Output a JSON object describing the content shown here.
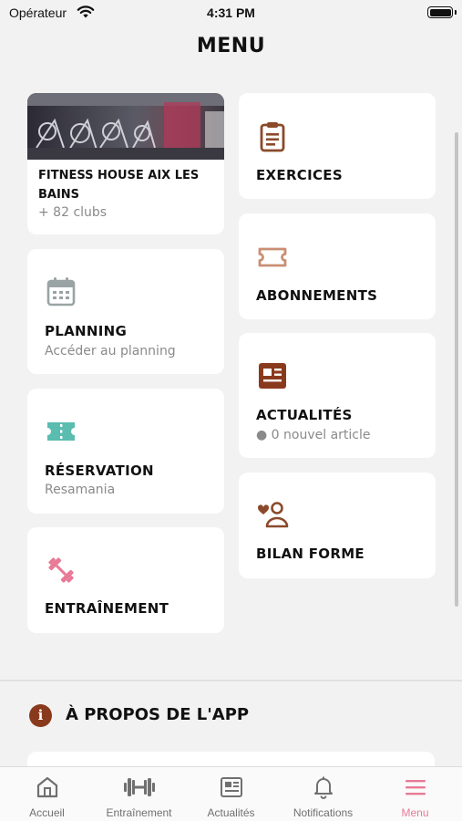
{
  "status_bar": {
    "carrier": "Opérateur",
    "time": "4:31 PM"
  },
  "header": {
    "title": "MENU"
  },
  "club_card": {
    "name": "FITNESS HOUSE AIX LES BAINS",
    "count": "+ 82 clubs"
  },
  "left_cards": [
    {
      "title": "PLANNING",
      "subtitle": "Accéder au planning",
      "icon": "calendar-icon"
    },
    {
      "title": "RÉSERVATION",
      "subtitle": "Resamania",
      "icon": "ticket-icon"
    },
    {
      "title": "ENTRAÎNEMENT",
      "icon": "dumbbell-icon"
    }
  ],
  "right_cards": [
    {
      "title": "EXERCICES",
      "icon": "clipboard-icon"
    },
    {
      "title": "ABONNEMENTS",
      "icon": "ticket-outline-icon"
    },
    {
      "title": "ACTUALITÉS",
      "subtitle": "● 0 nouvel article",
      "icon": "newspaper-icon"
    },
    {
      "title": "BILAN FORME",
      "icon": "user-heart-icon"
    }
  ],
  "about": {
    "title": "À PROPOS DE L'APP",
    "icon_glyph": "i"
  },
  "tabbar": [
    {
      "label": "Accueil",
      "icon": "home-icon",
      "active": false
    },
    {
      "label": "Entraînement",
      "icon": "dumbbell-icon",
      "active": false
    },
    {
      "label": "Actualités",
      "icon": "newspaper-icon",
      "active": false
    },
    {
      "label": "Notifications",
      "icon": "bell-icon",
      "active": false
    },
    {
      "label": "Menu",
      "icon": "hamburger-icon",
      "active": true
    }
  ],
  "colors": {
    "accent_pink": "#e87a96",
    "brown": "#8a4a2a",
    "teal": "#5bbcb0",
    "gray_icon": "#9aa3a3"
  }
}
